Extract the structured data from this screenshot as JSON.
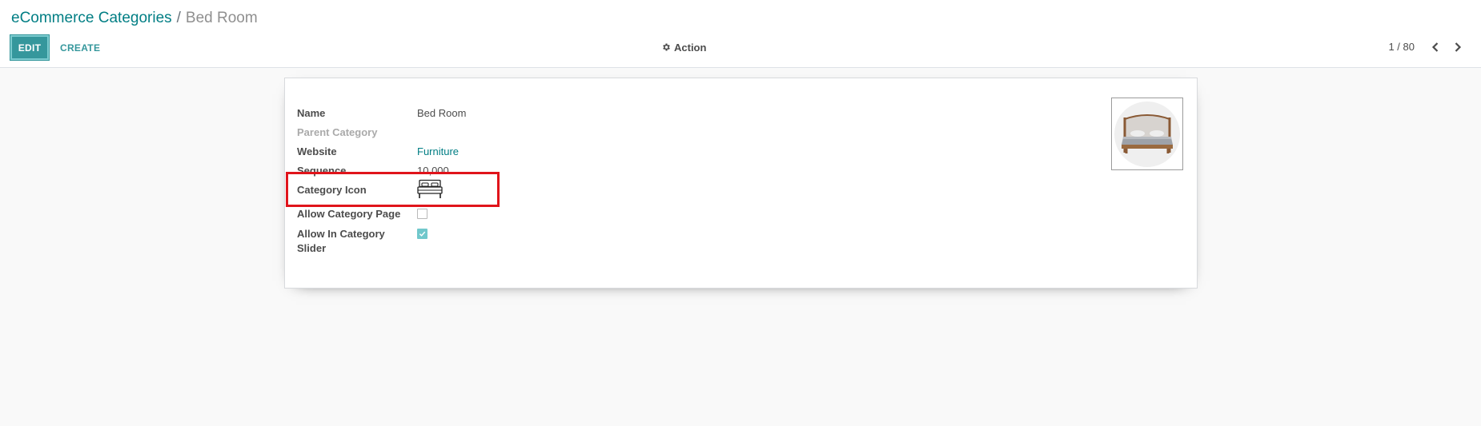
{
  "breadcrumb": {
    "parent": "eCommerce Categories",
    "separator": "/",
    "current": "Bed Room"
  },
  "toolbar": {
    "edit_label": "EDIT",
    "create_label": "CREATE",
    "action_label": "Action",
    "action_icon": "gear-icon"
  },
  "pager": {
    "value": "1 / 80",
    "prev_icon": "chevron-left-icon",
    "next_icon": "chevron-right-icon"
  },
  "form": {
    "fields": {
      "name": {
        "label": "Name",
        "value": "Bed Room"
      },
      "parent_category": {
        "label": "Parent Category",
        "value": ""
      },
      "website": {
        "label": "Website",
        "value": "Furniture"
      },
      "sequence": {
        "label": "Sequence",
        "value": "10,000"
      },
      "category_icon": {
        "label": "Category Icon",
        "icon": "bed-icon"
      },
      "allow_category_page": {
        "label": "Allow Category Page",
        "checked": false
      },
      "allow_in_category_slider": {
        "label_line1": "Allow In Category",
        "label_line2": "Slider",
        "checked": true
      }
    },
    "image": {
      "icon": "bed-image"
    }
  },
  "colors": {
    "primary": "#35979c",
    "link": "#017e84",
    "highlight": "#e0141b",
    "checkbox_checked": "#71c8cc"
  }
}
